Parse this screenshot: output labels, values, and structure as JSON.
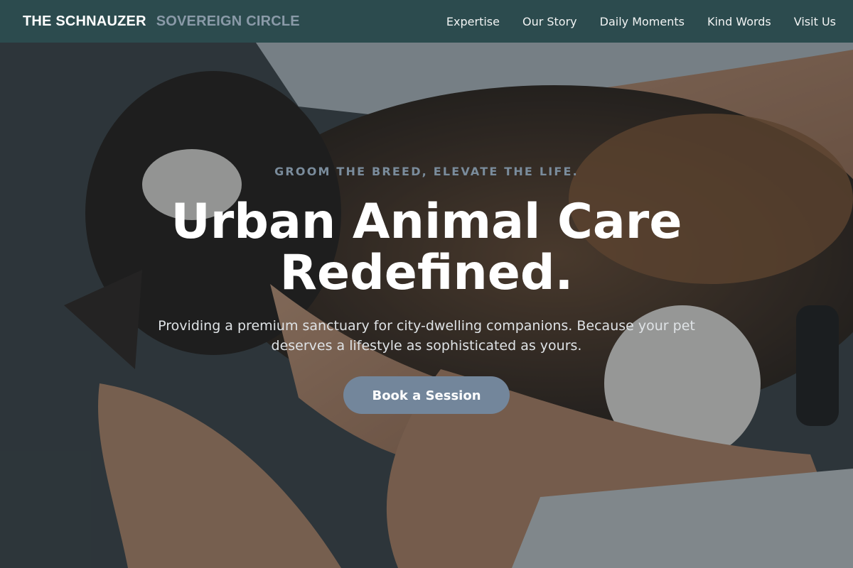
{
  "nav": {
    "brand_primary": "THE SCHNAUZER",
    "brand_secondary": "SOVEREIGN CIRCLE",
    "links": [
      {
        "label": "Expertise"
      },
      {
        "label": "Our Story"
      },
      {
        "label": "Daily Moments"
      },
      {
        "label": "Kind Words"
      },
      {
        "label": "Visit Us"
      }
    ]
  },
  "hero": {
    "tagline": "GROOM THE BREED, ELEVATE THE LIFE.",
    "headline": "Urban Animal Care Redefined.",
    "lede": "Providing a premium sanctuary for city-dwelling companions. Because your pet deserves a lifestyle as sophisticated as yours.",
    "cta_label": "Book a Session",
    "background_image": "person-cuddling-calico-cat-photo"
  },
  "colors": {
    "nav_background": "#2c4d50",
    "brand_secondary": "#8a9aa8",
    "tagline": "#7a8c9c",
    "cta_background": "#73869b",
    "headline": "#ffffff"
  }
}
